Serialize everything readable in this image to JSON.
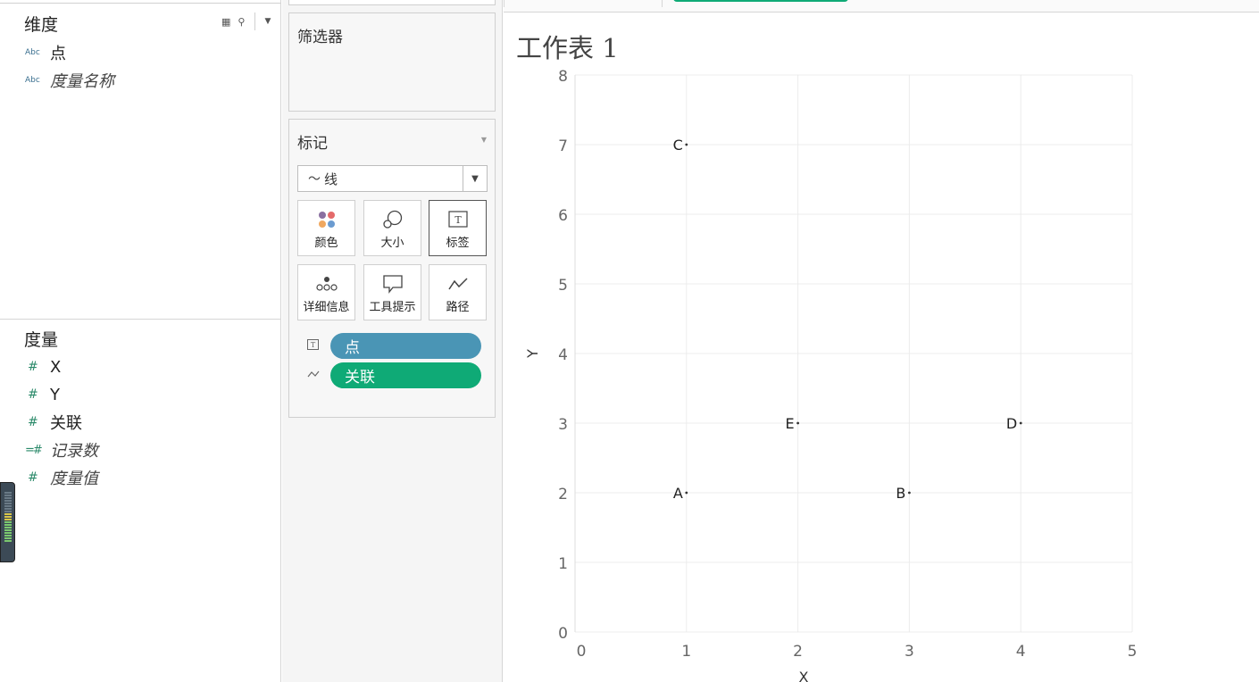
{
  "dimensions": {
    "title": "维度",
    "fields": [
      {
        "type": "Abc",
        "label": "点",
        "italic": false
      },
      {
        "type": "Abc",
        "label": "度量名称",
        "italic": true
      }
    ]
  },
  "measures": {
    "title": "度量",
    "fields": [
      {
        "type": "#",
        "label": "X",
        "italic": false
      },
      {
        "type": "#",
        "label": "Y",
        "italic": false
      },
      {
        "type": "#",
        "label": "关联",
        "italic": false
      },
      {
        "type": "=#",
        "label": "记录数",
        "italic": true
      },
      {
        "type": "#",
        "label": "度量值",
        "italic": true
      }
    ]
  },
  "cards": {
    "filters_title": "筛选器",
    "marks_title": "标记",
    "mark_type": "线",
    "buttons": {
      "color": "颜色",
      "size": "大小",
      "label": "标签",
      "detail": "详细信息",
      "tooltip": "工具提示",
      "path": "路径"
    },
    "pills": [
      {
        "icon": "text-icon",
        "label": "点",
        "color": "#4a95b5"
      },
      {
        "icon": "line-path-icon",
        "label": "关联",
        "color": "#0faa76"
      }
    ]
  },
  "sheet": {
    "title": "工作表 1"
  },
  "chart_data": {
    "type": "scatter",
    "xlabel": "X",
    "ylabel": "Y",
    "xlim": [
      0,
      5
    ],
    "ylim": [
      0,
      8
    ],
    "xticks": [
      0,
      1,
      2,
      3,
      4,
      5
    ],
    "yticks": [
      0,
      1,
      2,
      3,
      4,
      5,
      6,
      7,
      8
    ],
    "grid": true,
    "points": [
      {
        "label": "A",
        "x": 1,
        "y": 2
      },
      {
        "label": "B",
        "x": 3,
        "y": 2
      },
      {
        "label": "C",
        "x": 1,
        "y": 7
      },
      {
        "label": "D",
        "x": 4,
        "y": 3
      },
      {
        "label": "E",
        "x": 2,
        "y": 3
      }
    ]
  }
}
